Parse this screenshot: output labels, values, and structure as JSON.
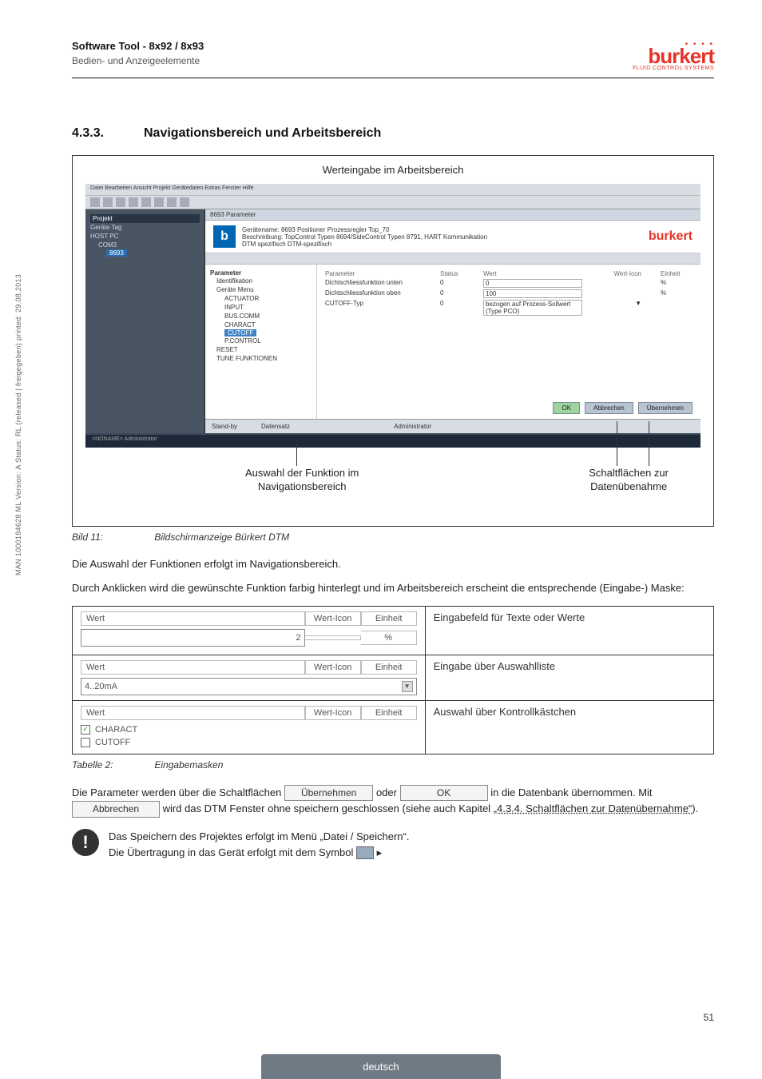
{
  "header": {
    "title": "Software Tool - 8x92 / 8x93",
    "subtitle": "Bedien- und Anzeigeelemente",
    "logo_text": "burkert",
    "logo_sub": "FLUID CONTROL SYSTEMS"
  },
  "sidebar_meta": "MAN 1000184628 ML Version: A Status: RL (released | freigegeben) printed: 29.08.2013",
  "section": {
    "number": "4.3.3.",
    "title": "Navigationsbereich und Arbeitsbereich"
  },
  "figure": {
    "top_annot": "Werteingabe im Arbeitsbereich",
    "annot_left_l1": "Auswahl der Funktion im",
    "annot_left_l2": "Navigationsbereich",
    "annot_right_l1": "Schaltflächen zur",
    "annot_right_l2": "Datenübenahme",
    "caption_label": "Bild 11:",
    "caption_text": "Bildschirmanzeige Bürkert DTM"
  },
  "screenshot": {
    "menubar": "Datei   Bearbeiten   Ansicht   Projekt   Gerätedaten   Extras   Fenster   Hilfe",
    "tree": {
      "title": "Projekt",
      "items": [
        "Geräte Tag",
        "HOST PC",
        "COM3",
        "8693"
      ]
    },
    "banner": {
      "tab": "8693 Parameter",
      "l1": "Gerätename:",
      "l1v": "8693 Positioner Prozessregler Top_70",
      "l2": "Beschreibung:",
      "l2v": "TopControl Typen 8694/SideControl Typen 8791, HART Kommunikation",
      "l3": "DTM spezifisch",
      "l3v": "DTM-spezifisch",
      "logo": "burkert"
    },
    "nav": {
      "header": "Parameter",
      "items": [
        "Identifikation",
        "Geräte Menu",
        "ACTUATOR",
        "INPUT",
        "BUS.COMM",
        "CHARACT",
        "CUTOFF",
        "P.CONTROL",
        "RESET",
        "TUNE FUNKTIONEN"
      ],
      "highlighted": "CUTOFF"
    },
    "table": {
      "headers": [
        "Parameter",
        "Status",
        "Wert",
        "Wert-Icon",
        "Einheit"
      ],
      "rows": [
        {
          "p": "Dichtschliessfunktion unten",
          "s": "0",
          "w": "0",
          "e": "%"
        },
        {
          "p": "Dichtschliessfunktion oben",
          "s": "0",
          "w": "100",
          "e": "%"
        },
        {
          "p": "CUTOFF-Typ",
          "s": "0",
          "w": "bezogen auf Prozess-Sollwert (Type PCO)",
          "e": ""
        }
      ]
    },
    "buttons": {
      "ok": "OK",
      "cancel": "Abbrechen",
      "apply": "Übernehmen"
    },
    "status": {
      "s1": "Stand-by",
      "s2": "Datensatz",
      "s3": "Administrator"
    },
    "footbar": "<NONAME>       Administrator"
  },
  "para1": "Die Auswahl der Funktionen erfolgt im Navigationsbereich.",
  "para2": "Durch Anklicken wird die gewünschte Funktion farbig hinterlegt und im Arbeitsbereich erscheint die entsprechende (Eingabe-) Maske:",
  "mask_table": {
    "r1": {
      "label": "Wert",
      "icon": "Wert-Icon",
      "unit": "Einheit",
      "input_value": "2",
      "input_unit": "%",
      "desc": "Eingabefeld für Texte oder Werte"
    },
    "r2": {
      "label": "Wert",
      "icon": "Wert-Icon",
      "unit": "Einheit",
      "select_value": "4..20mA",
      "desc": "Eingabe über Auswahlliste"
    },
    "r3": {
      "label": "Wert",
      "icon": "Wert-Icon",
      "unit": "Einheit",
      "check1": "CHARACT",
      "check2": "CUTOFF",
      "desc": "Auswahl über Kontrollkästchen"
    }
  },
  "table_caption": {
    "label": "Tabelle 2:",
    "text": "Eingabemasken"
  },
  "para3": {
    "t1": "Die Parameter werden über die Schaltflächen ",
    "btn1": "Übernehmen",
    "t2": " oder ",
    "btn2": "OK",
    "t3": " in die Datenbank übernommen. Mit ",
    "btn3": "Abbrechen",
    "t4": " wird das DTM Fenster ohne speichern geschlossen (siehe auch Kapitel ",
    "link": "„4.3.4. Schaltflächen zur Datenübernahme“",
    "t5": ")."
  },
  "note": {
    "l1": "Das Speichern des Projektes erfolgt im Menü „Datei / Speichern“.",
    "l2": "Die Übertragung in das Gerät erfolgt mit dem Symbol "
  },
  "page_number": "51",
  "lang": "deutsch"
}
